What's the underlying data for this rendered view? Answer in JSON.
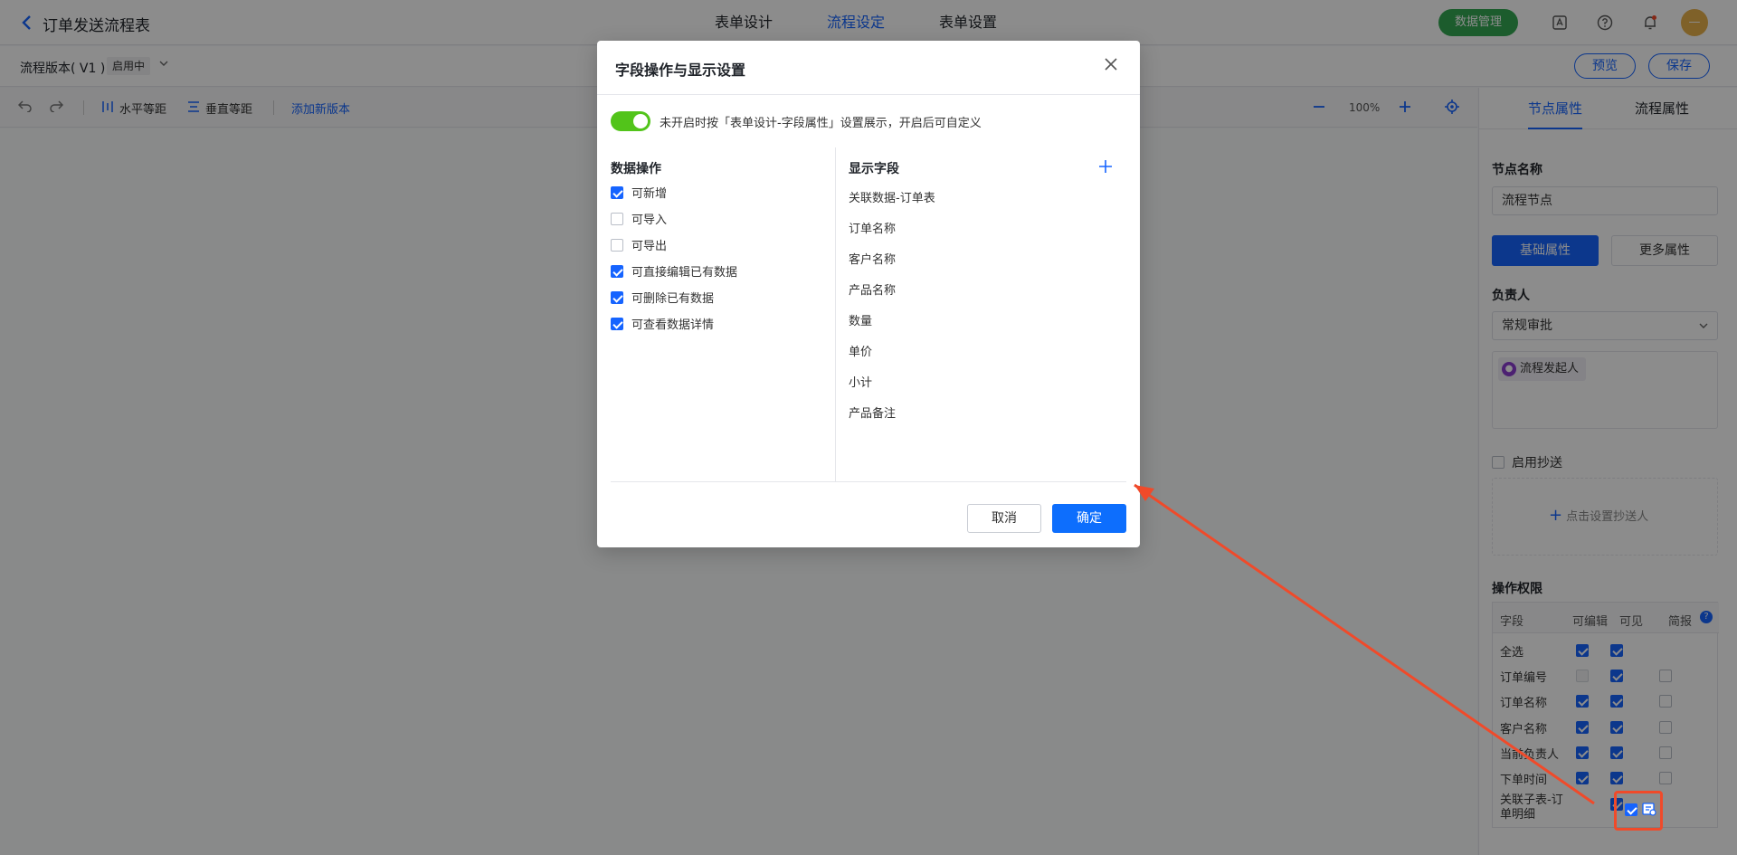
{
  "header": {
    "title": "订单发送流程表",
    "tabs": [
      {
        "label": "表单设计"
      },
      {
        "label": "流程设定"
      },
      {
        "label": "表单设置"
      }
    ],
    "data_mgmt_label": "数据管理",
    "avatar_text": "—"
  },
  "version_bar": {
    "version_text": "流程版本( V1 )",
    "status_badge": "启用中",
    "preview_label": "预览",
    "save_label": "保存"
  },
  "toolbar": {
    "horizontal_label": "水平等距",
    "vertical_label": "垂直等距",
    "add_version_label": "添加新版本",
    "zoom": "100%"
  },
  "panel": {
    "tabs": [
      {
        "label": "节点属性"
      },
      {
        "label": "流程属性"
      }
    ],
    "node_name_label": "节点名称",
    "node_name_value": "流程节点",
    "basic_attr_label": "基础属性",
    "more_attr_label": "更多属性",
    "owner_label": "负责人",
    "approval_type": "常规审批",
    "initiator_tag": "流程发起人",
    "cc_label": "启用抄送",
    "cc_add_label": "点击设置抄送人",
    "perm_label": "操作权限",
    "perm_headers": {
      "field": "字段",
      "editable": "可编辑",
      "visible": "可见",
      "brief": "简报"
    },
    "perm_rows": [
      {
        "name": "全选",
        "editable": true,
        "visible": true,
        "brief": null
      },
      {
        "name": "订单编号",
        "editable": "disabled",
        "visible": true,
        "brief": false
      },
      {
        "name": "订单名称",
        "editable": true,
        "visible": true,
        "brief": false
      },
      {
        "name": "客户名称",
        "editable": true,
        "visible": true,
        "brief": false
      },
      {
        "name": "当前负责人",
        "editable": true,
        "visible": true,
        "brief": false
      },
      {
        "name": "下单时间",
        "editable": true,
        "visible": true,
        "brief": false
      },
      {
        "name": "关联子表-订单明细",
        "editable": null,
        "visible": true,
        "brief": null
      }
    ]
  },
  "modal": {
    "title": "字段操作与显示设置",
    "toggle_on": true,
    "toggle_text": "未开启时按「表单设计-字段属性」设置展示，开启后可自定义",
    "ops_title": "数据操作",
    "ops": [
      {
        "label": "可新增",
        "checked": true
      },
      {
        "label": "可导入",
        "checked": false
      },
      {
        "label": "可导出",
        "checked": false
      },
      {
        "label": "可直接编辑已有数据",
        "checked": true
      },
      {
        "label": "可删除已有数据",
        "checked": true
      },
      {
        "label": "可查看数据详情",
        "checked": true
      }
    ],
    "fields_title": "显示字段",
    "fields": [
      {
        "label": "关联数据-订单表"
      },
      {
        "label": "订单名称"
      },
      {
        "label": "客户名称"
      },
      {
        "label": "产品名称"
      },
      {
        "label": "数量"
      },
      {
        "label": "单价"
      },
      {
        "label": "小计"
      },
      {
        "label": "产品备注"
      }
    ],
    "cancel_label": "取消",
    "ok_label": "确定"
  },
  "colors": {
    "accent": "#1664ff",
    "toggle": "#52c41a",
    "data_button": "#34a853",
    "annotation": "#f04a2a"
  }
}
